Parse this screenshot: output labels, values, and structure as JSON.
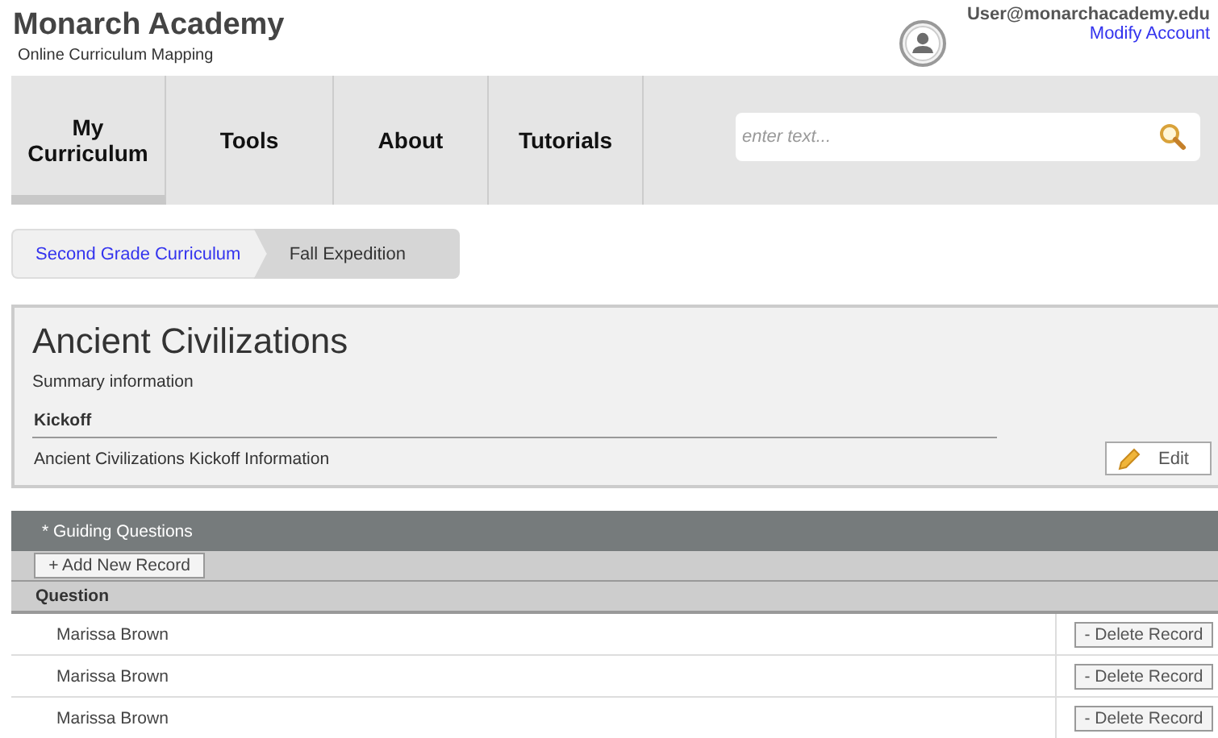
{
  "header": {
    "title": "Monarch Academy",
    "subtitle": "Online Curriculum Mapping",
    "user": "User@monarchacademy.edu",
    "account_link": "Modify Account"
  },
  "nav": {
    "tabs": [
      {
        "label": "My Curriculum",
        "selected": true
      },
      {
        "label": "Tools",
        "selected": false
      },
      {
        "label": "About",
        "selected": false
      },
      {
        "label": "Tutorials",
        "selected": false
      }
    ],
    "search": {
      "placeholder": "enter text..."
    }
  },
  "breadcrumb": [
    {
      "label": "Second Grade Curriculum",
      "selected": false
    },
    {
      "label": "Fall Expedition",
      "selected": true
    }
  ],
  "summary": {
    "title": "Ancient Civilizations",
    "subtitle": "Summary information",
    "section": "Kickoff",
    "text": "Ancient Civilizations Kickoff Information",
    "edit_button": "Edit"
  },
  "guiding_questions": {
    "title": "* Guiding Questions",
    "add_button": "+ Add New Record",
    "columns": [
      "Question"
    ],
    "rows": [
      {
        "question": "Marissa Brown",
        "action": "- Delete Record"
      },
      {
        "question": "Marissa Brown",
        "action": "- Delete Record"
      },
      {
        "question": "Marissa Brown",
        "action": "- Delete Record"
      }
    ]
  }
}
